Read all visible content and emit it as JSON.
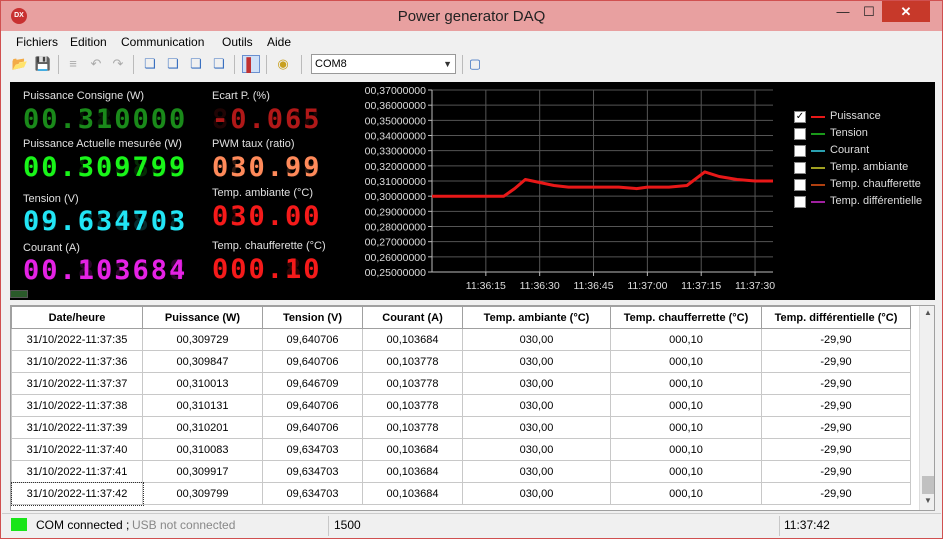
{
  "window": {
    "title": "Power generator DAQ",
    "icon_text": "DX",
    "min": "—",
    "max": "☐",
    "close": "✕"
  },
  "menu": [
    "Fichiers",
    "Edition",
    "Communication",
    "Outils",
    "Aide"
  ],
  "toolbar": {
    "com_port": "COM8"
  },
  "readouts": {
    "puissance_consigne": {
      "label": "Puissance Consigne (W)",
      "value": "00.310000",
      "color": "#1a8a1a"
    },
    "ecart_p": {
      "label": "Ecart P. (%)",
      "value": "-0.065",
      "color": "#b01818"
    },
    "puissance_actuelle": {
      "label": "Puissance Actuelle mesurée (W)",
      "value": "00.309799",
      "color": "#19f519"
    },
    "pwm": {
      "label": "PWM taux (ratio)",
      "value": "030.99",
      "color": "#ff8a5a"
    },
    "tension": {
      "label": "Tension (V)",
      "value": "09.634703",
      "color": "#22e5f5"
    },
    "temp_ambiante": {
      "label": "Temp. ambiante (°C)",
      "value": "030.00",
      "color": "#f51a1a"
    },
    "courant": {
      "label": "Courant (A)",
      "value": "00.103684",
      "color": "#e522e5"
    },
    "temp_chaufferette": {
      "label": "Temp. chaufferette (°C)",
      "value": "000.10",
      "color": "#f51a1a"
    }
  },
  "chart_data": {
    "type": "line",
    "title": "",
    "xlabel": "",
    "ylabel": "",
    "ylim": [
      0.25,
      0.37
    ],
    "y_ticks": [
      "00,37000000",
      "00,36000000",
      "00,35000000",
      "00,34000000",
      "00,33000000",
      "00,32000000",
      "00,31000000",
      "00,30000000",
      "00,29000000",
      "00,28000000",
      "00,27000000",
      "00,26000000",
      "00,25000000"
    ],
    "x_ticks": [
      "11:36:15",
      "11:36:30",
      "11:36:45",
      "11:37:00",
      "11:37:15",
      "11:37:30"
    ],
    "x_tick_seconds": [
      15,
      30,
      45,
      60,
      75,
      90
    ],
    "xlim_seconds": [
      0,
      95
    ],
    "grid": true,
    "legend_placement": "right",
    "series": [
      {
        "name": "Puissance",
        "color": "#e81818",
        "visible": true,
        "points": [
          [
            0,
            0.3
          ],
          [
            8,
            0.3
          ],
          [
            15,
            0.3
          ],
          [
            20,
            0.3
          ],
          [
            23,
            0.305
          ],
          [
            26,
            0.311
          ],
          [
            30,
            0.309
          ],
          [
            34,
            0.307
          ],
          [
            38,
            0.306
          ],
          [
            45,
            0.306
          ],
          [
            52,
            0.306
          ],
          [
            57,
            0.305
          ],
          [
            60,
            0.306
          ],
          [
            66,
            0.306
          ],
          [
            71,
            0.307
          ],
          [
            76,
            0.316
          ],
          [
            80,
            0.313
          ],
          [
            85,
            0.311
          ],
          [
            90,
            0.31
          ],
          [
            95,
            0.31
          ]
        ]
      }
    ],
    "legend": [
      {
        "name": "Puissance",
        "color": "#e81818",
        "checked": true
      },
      {
        "name": "Tension",
        "color": "#1a9a1a",
        "checked": false
      },
      {
        "name": "Courant",
        "color": "#2aa0b0",
        "checked": false
      },
      {
        "name": "Temp. ambiante",
        "color": "#a0a020",
        "checked": false
      },
      {
        "name": "Temp. chaufferette",
        "color": "#b04010",
        "checked": false
      },
      {
        "name": "Temp. différentielle",
        "color": "#a020a0",
        "checked": false
      }
    ]
  },
  "table": {
    "columns": [
      "Date/heure",
      "Puissance (W)",
      "Tension (V)",
      "Courant (A)",
      "Temp. ambiante (°C)",
      "Temp. chaufferrette (°C)",
      "Temp. différentielle (°C)"
    ],
    "rows": [
      [
        "31/10/2022-11:37:35",
        "00,309729",
        "09,640706",
        "00,103684",
        "030,00",
        "000,10",
        "-29,90"
      ],
      [
        "31/10/2022-11:37:36",
        "00,309847",
        "09,640706",
        "00,103778",
        "030,00",
        "000,10",
        "-29,90"
      ],
      [
        "31/10/2022-11:37:37",
        "00,310013",
        "09,646709",
        "00,103778",
        "030,00",
        "000,10",
        "-29,90"
      ],
      [
        "31/10/2022-11:37:38",
        "00,310131",
        "09,640706",
        "00,103778",
        "030,00",
        "000,10",
        "-29,90"
      ],
      [
        "31/10/2022-11:37:39",
        "00,310201",
        "09,640706",
        "00,103778",
        "030,00",
        "000,10",
        "-29,90"
      ],
      [
        "31/10/2022-11:37:40",
        "00,310083",
        "09,634703",
        "00,103684",
        "030,00",
        "000,10",
        "-29,90"
      ],
      [
        "31/10/2022-11:37:41",
        "00,309917",
        "09,634703",
        "00,103684",
        "030,00",
        "000,10",
        "-29,90"
      ],
      [
        "31/10/2022-11:37:42",
        "00,309799",
        "09,634703",
        "00,103684",
        "030,00",
        "000,10",
        "-29,90"
      ]
    ]
  },
  "status": {
    "com": "COM connected ;",
    "usb": "USB not connected",
    "count": "1500",
    "time": "11:37:42",
    "led_color": "#19e519"
  }
}
